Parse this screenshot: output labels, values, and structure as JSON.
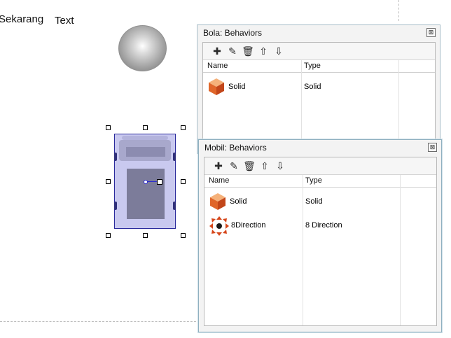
{
  "canvas": {
    "label1": "Sekarang",
    "label2": "Text"
  },
  "panel_bola": {
    "title": "Bola: Behaviors",
    "close_label": "⊠",
    "toolbar": {
      "add": "✚",
      "edit": "✎",
      "delete": "🗑",
      "up": "⇧",
      "down": "⇩"
    },
    "columns": [
      "Name",
      "Type"
    ],
    "rows": [
      {
        "name": "Solid",
        "type": "Solid",
        "icon": "solid-cube-icon"
      }
    ]
  },
  "panel_mobil": {
    "title": "Mobil: Behaviors",
    "close_label": "⊠",
    "toolbar": {
      "add": "✚",
      "edit": "✎",
      "delete": "🗑",
      "up": "⇧",
      "down": "⇩"
    },
    "columns": [
      "Name",
      "Type"
    ],
    "rows": [
      {
        "name": "Solid",
        "type": "Solid",
        "icon": "solid-cube-icon"
      },
      {
        "name": "8Direction",
        "type": "8 Direction",
        "icon": "eight-direction-icon"
      }
    ]
  }
}
